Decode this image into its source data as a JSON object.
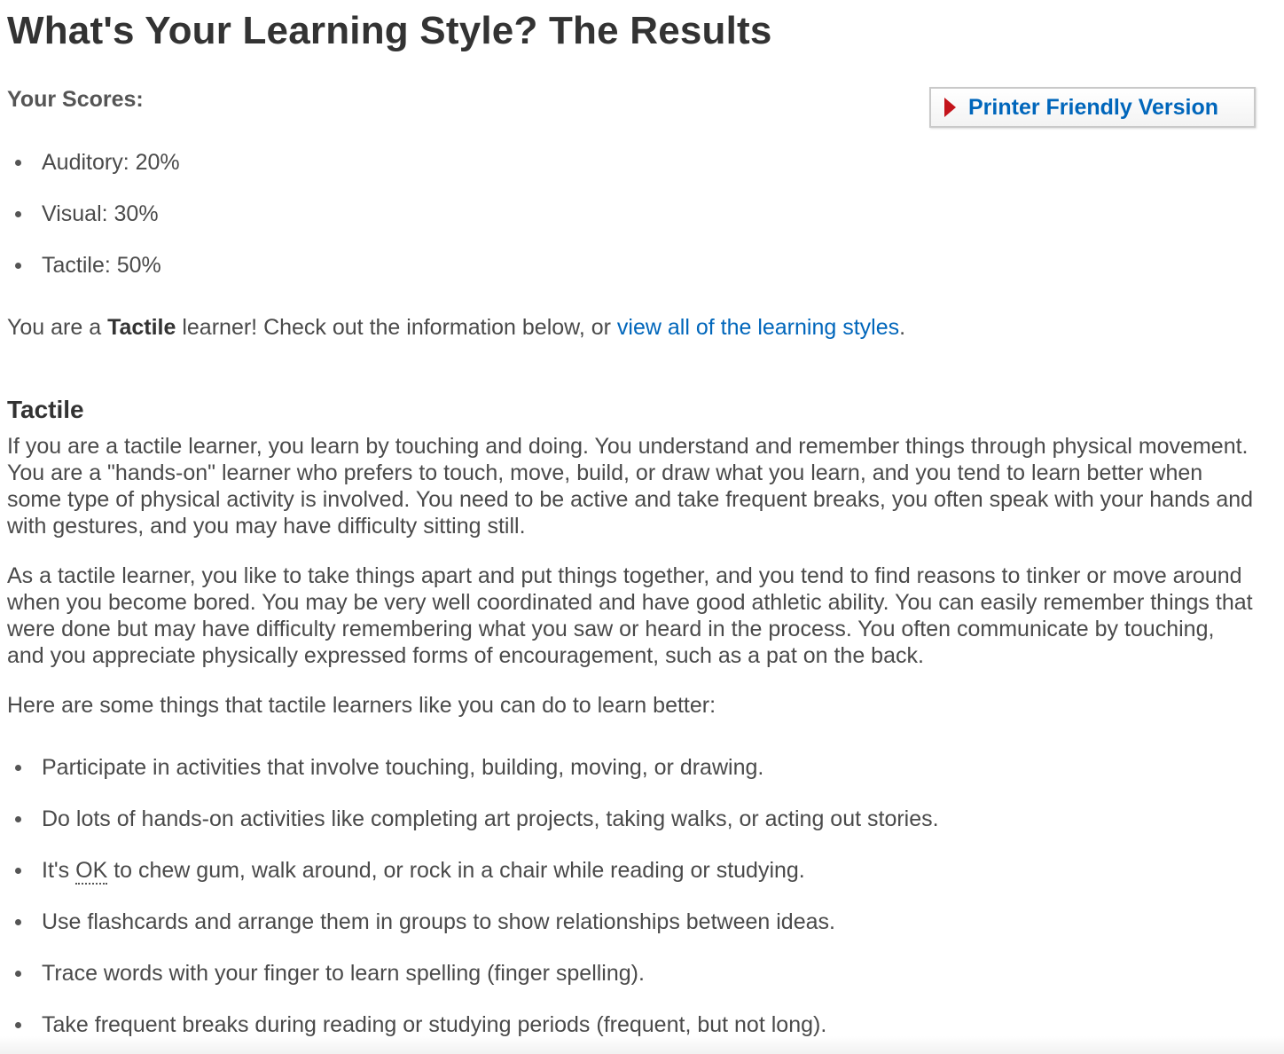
{
  "page": {
    "title": "What's Your Learning Style? The Results"
  },
  "scores": {
    "label": "Your Scores:",
    "items": [
      {
        "text": "Auditory: 20%"
      },
      {
        "text": "Visual: 30%"
      },
      {
        "text": "Tactile: 50%"
      }
    ]
  },
  "printer_button": {
    "label": "Printer Friendly Version",
    "arrow_color": "#c4141b",
    "text_color": "#0066bb"
  },
  "result": {
    "prefix": "You are a ",
    "style": "Tactile",
    "suffix": " learner! Check out the information below, or ",
    "link_text": "view all of the learning styles",
    "end": "."
  },
  "section": {
    "title": "Tactile",
    "paragraph1": "If you are a tactile learner, you learn by touching and doing. You understand and remember things through physical movement. You are a \"hands-on\" learner who prefers to touch, move, build, or draw what you learn, and you tend to learn better when some type of physical activity is involved. You need to be active and take frequent breaks, you often speak with your hands and with gestures, and you may have difficulty sitting still.",
    "paragraph2": "As a tactile learner, you like to take things apart and put things together, and you tend to find reasons to tinker or move around when you become bored. You may be very well coordinated and have good athletic ability. You can easily remember things that were done but may have difficulty remembering what you saw or heard in the process. You often communicate by touching, and you appreciate physically expressed forms of encouragement, such as a pat on the back.",
    "tips_intro": "Here are some things that tactile learners like you can do to learn better:",
    "tips": [
      {
        "text": "Participate in activities that involve touching, building, moving, or drawing."
      },
      {
        "text": "Do lots of hands-on activities like completing art projects, taking walks, or acting out stories."
      },
      {
        "pre": "It's ",
        "abbr": "OK",
        "post": " to chew gum, walk around, or rock in a chair while reading or studying."
      },
      {
        "text": "Use flashcards and arrange them in groups to show relationships between ideas."
      },
      {
        "text": "Trace words with your finger to learn spelling (finger spelling)."
      },
      {
        "text": "Take frequent breaks during reading or studying periods (frequent, but not long)."
      }
    ]
  }
}
